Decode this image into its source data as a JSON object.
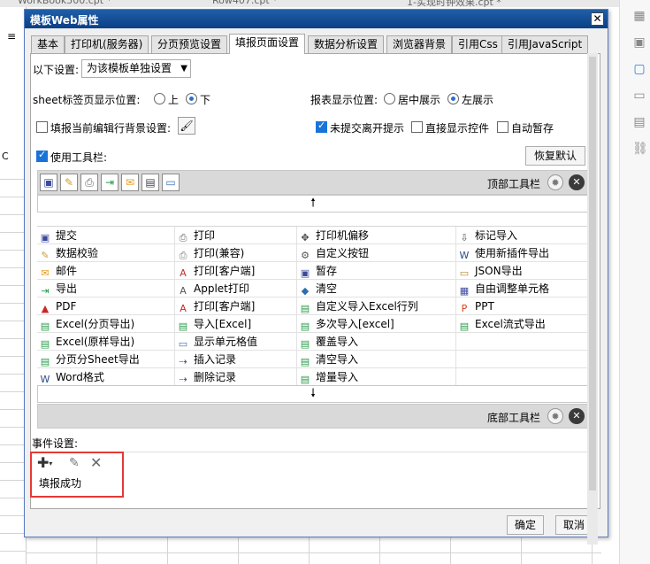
{
  "background": {
    "tabs": [
      "WorkBook500.cpt *",
      "Row407.cpt *",
      "1-实现时钟效果.cpt *"
    ],
    "left_letter": "C"
  },
  "dialog": {
    "title": "模板Web属性",
    "close": "✕",
    "tabs": [
      "基本",
      "打印机(服务器)",
      "分页预览设置",
      "填报页面设置",
      "数据分析设置",
      "浏览器背景",
      "引用Css",
      "引用JavaScript"
    ],
    "settings_label": "以下设置:",
    "settings_select": "为该模板单独设置",
    "sheet_label": "sheet标签页显示位置:",
    "radio_top": "上",
    "radio_bottom": "下",
    "report_label": "报表显示位置:",
    "radio_center": "居中展示",
    "radio_left": "左展示",
    "bg_label": "填报当前编辑行背景设置:",
    "unsubmitted": "未提交离开提示",
    "direct_control": "直接显示控件",
    "autosave": "自动暂存",
    "use_toolbar": "使用工具栏:",
    "restore_default": "恢复默认",
    "top_toolbar": "顶部工具栏",
    "bottom_toolbar": "底部工具栏",
    "event_label": "事件设置:",
    "event_item": "填报成功",
    "ok": "确定",
    "cancel": "取消"
  },
  "grid_rows": [
    [
      "提交",
      "打印",
      "打印机偏移",
      "标记导入"
    ],
    [
      "数据校验",
      "打印(兼容)",
      "自定义按钮",
      "使用新插件导出"
    ],
    [
      "邮件",
      "打印[客户端]",
      "暂存",
      "JSON导出"
    ],
    [
      "导出",
      "Applet打印",
      "清空",
      "自由调整单元格"
    ],
    [
      "PDF",
      "打印[客户端]",
      "自定义导入Excel行列",
      "PPT"
    ],
    [
      "Excel(分页导出)",
      "导入[Excel]",
      "多次导入[excel]",
      "Excel流式导出"
    ],
    [
      "Excel(原样导出)",
      "显示单元格值",
      "覆盖导入",
      ""
    ],
    [
      "分页分Sheet导出",
      "插入记录",
      "清空导入",
      ""
    ],
    [
      "Word格式",
      "删除记录",
      "增量导入",
      ""
    ]
  ],
  "icons": {
    "top_toolbar": [
      "save-icon",
      "pencil-icon",
      "printer-icon",
      "export-icon",
      "mail-icon",
      "grid-icon",
      "window-icon"
    ]
  }
}
